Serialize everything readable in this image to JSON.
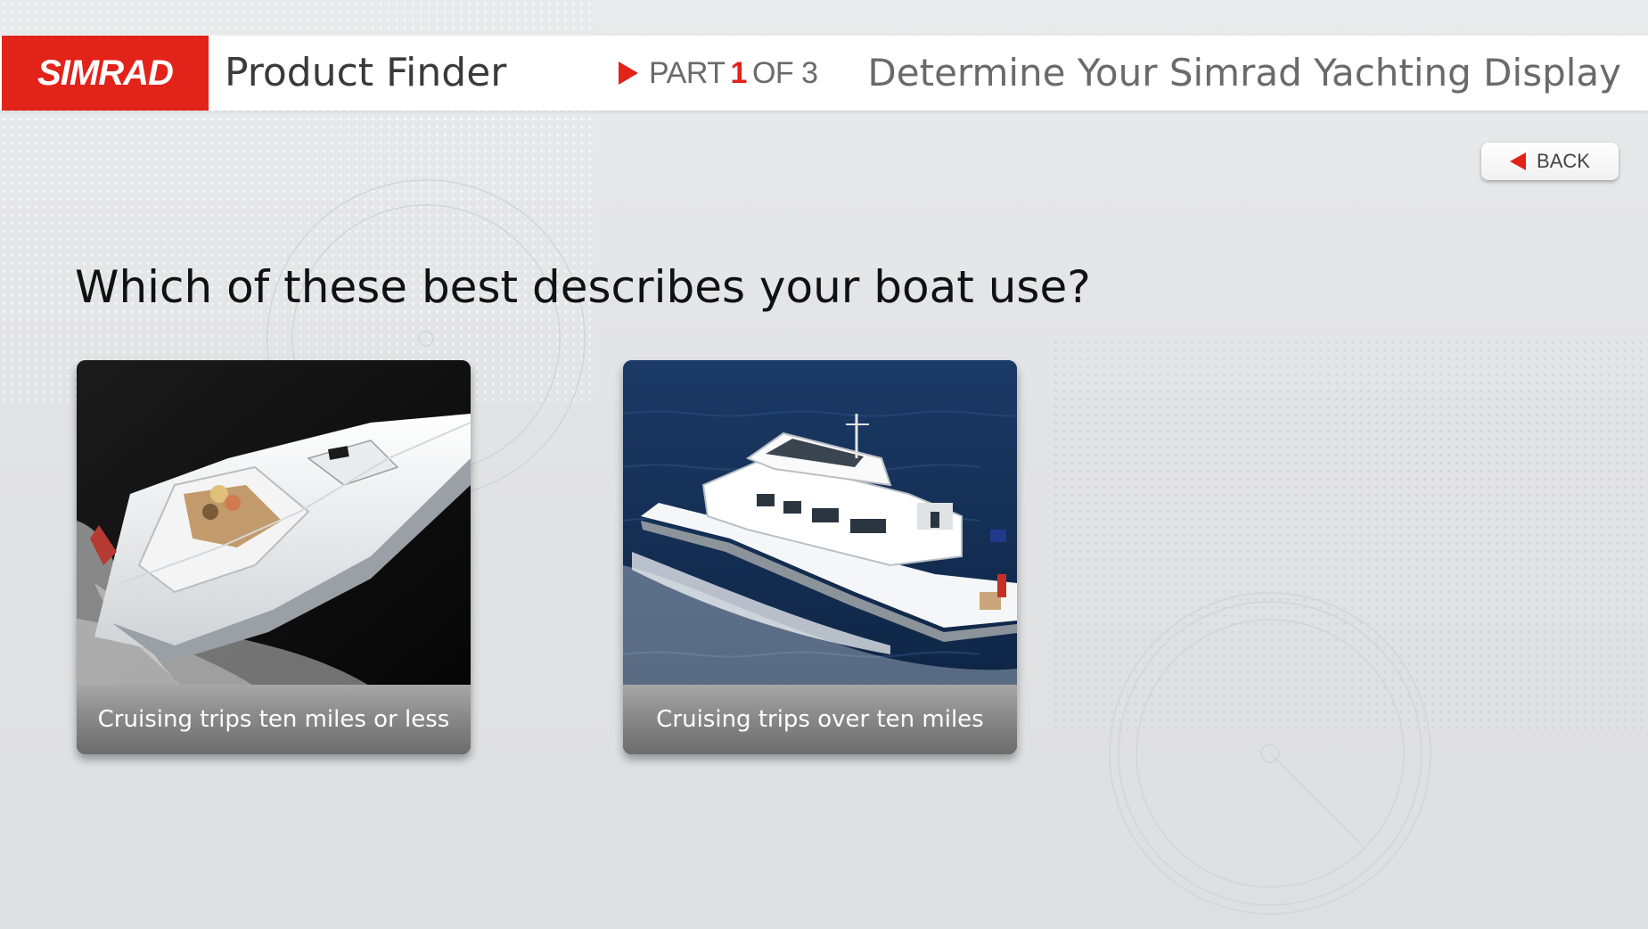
{
  "header": {
    "logo_text": "SIMRAD",
    "app_title": "Product Finder",
    "part_prefix": "PART",
    "part_number": "1",
    "part_suffix": "OF 3",
    "subtitle": "Determine Your Simrad Yachting Display"
  },
  "back_button": {
    "label": "BACK"
  },
  "question": "Which of these best describes your boat use?",
  "options": [
    {
      "label": "Cruising trips ten miles or less",
      "icon": "speed-boat-photo"
    },
    {
      "label": "Cruising trips over ten miles",
      "icon": "motor-yacht-photo"
    }
  ],
  "colors": {
    "brand_red": "#e2231a",
    "background": "#e4e5e7",
    "card_label_bg": "#8a8a8a"
  }
}
